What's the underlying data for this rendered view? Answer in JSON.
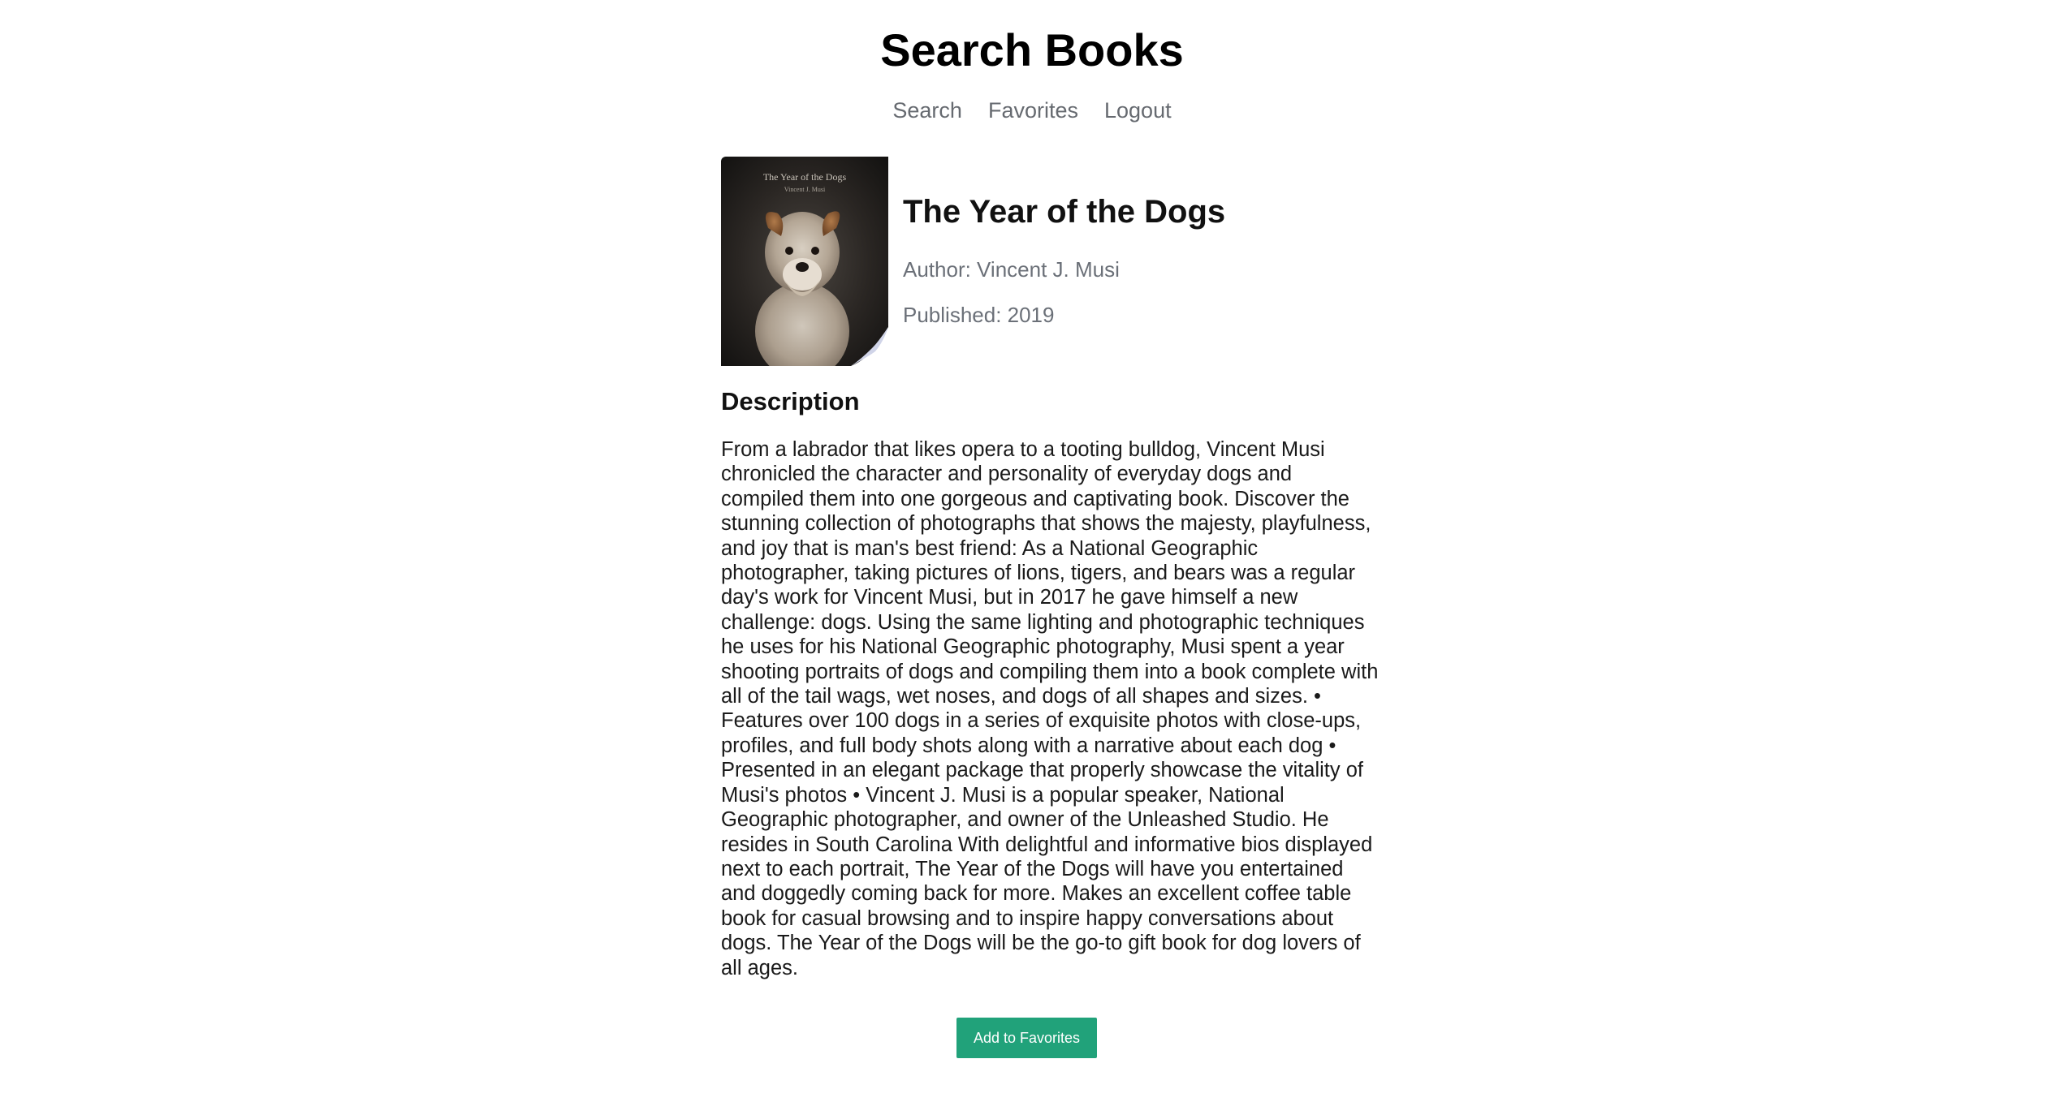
{
  "header": {
    "title": "Search Books"
  },
  "nav": {
    "items": [
      {
        "label": "Search"
      },
      {
        "label": "Favorites"
      },
      {
        "label": "Logout"
      }
    ]
  },
  "book": {
    "cover_title": "The Year of the Dogs",
    "cover_author": "Vincent J. Musi",
    "title": "The Year of the Dogs",
    "author_line": "Author: Vincent J. Musi",
    "published_line": "Published: 2019",
    "description_heading": "Description",
    "description": "From a labrador that likes opera to a tooting bulldog, Vincent Musi chronicled the character and personality of everyday dogs and compiled them into one gorgeous and captivating book. Discover the stunning collection of photographs that shows the majesty, playfulness, and joy that is man's best friend: As a National Geographic photographer, taking pictures of lions, tigers, and bears was a regular day's work for Vincent Musi, but in 2017 he gave himself a new challenge: dogs. Using the same lighting and photographic techniques he uses for his National Geographic photography, Musi spent a year shooting portraits of dogs and compiling them into a book complete with all of the tail wags, wet noses, and dogs of all shapes and sizes. • Features over 100 dogs in a series of exquisite photos with close-ups, profiles, and full body shots along with a narrative about each dog • Presented in an elegant package that properly showcase the vitality of Musi's photos • Vincent J. Musi is a popular speaker, National Geographic photographer, and owner of the Unleashed Studio. He resides in South Carolina With delightful and informative bios displayed next to each portrait, The Year of the Dogs will have you entertained and doggedly coming back for more. Makes an excellent coffee table book for casual browsing and to inspire happy conversations about dogs. The Year of the Dogs will be the go-to gift book for dog lovers of all ages."
  },
  "actions": {
    "add_to_favorites_label": "Add to Favorites"
  },
  "colors": {
    "accent": "#21a27a",
    "muted_text": "#6b7078",
    "nav_text": "#666a70"
  },
  "icons": {
    "cover_image": "dog-portrait-cover"
  }
}
